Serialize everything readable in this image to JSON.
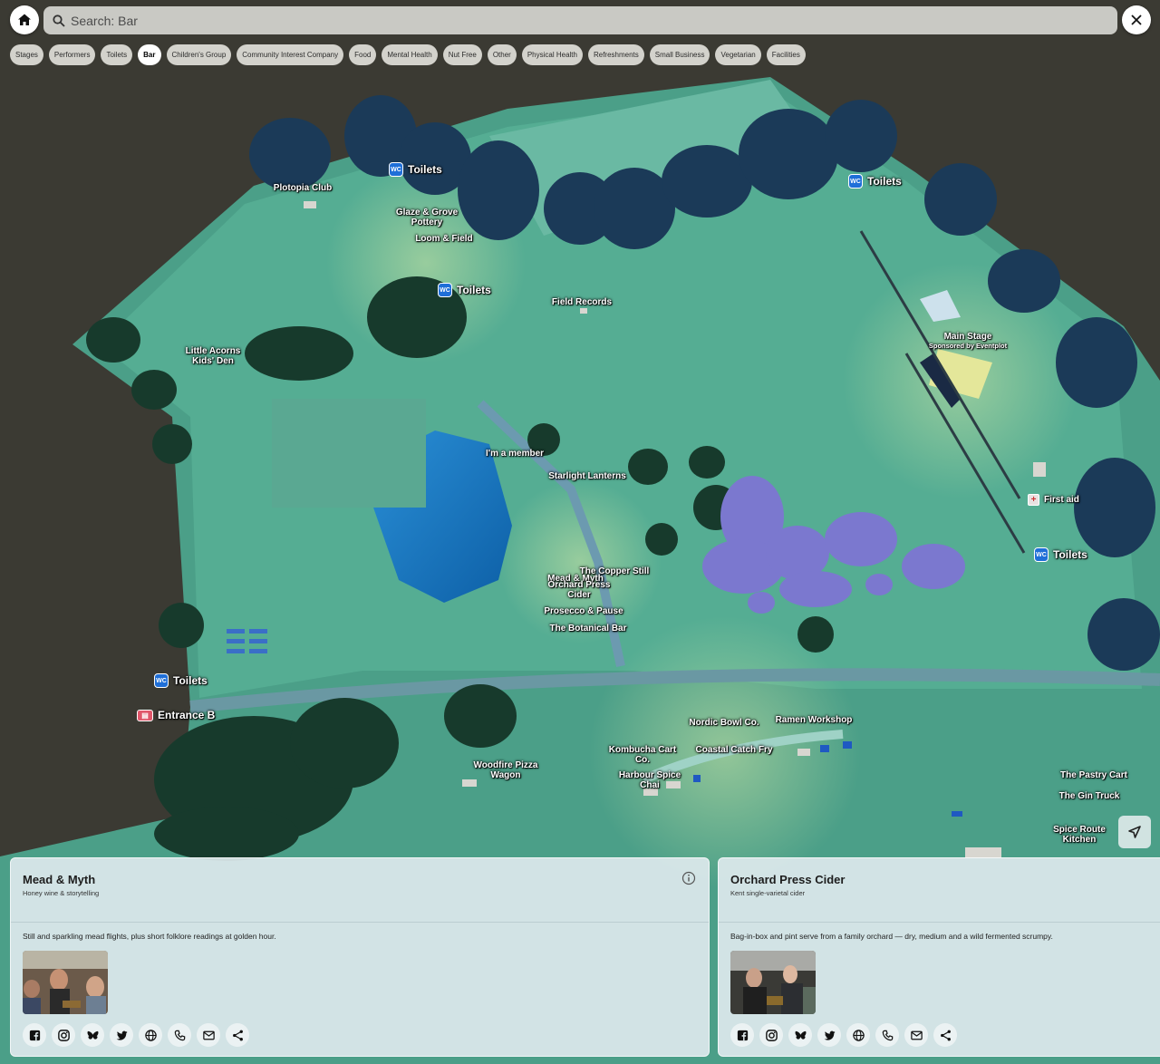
{
  "search": {
    "placeholder": "Search: Bar"
  },
  "filters": [
    {
      "label": "Stages",
      "active": false
    },
    {
      "label": "Performers",
      "active": false
    },
    {
      "label": "Toilets",
      "active": false
    },
    {
      "label": "Bar",
      "active": true
    },
    {
      "label": "Children's Group",
      "active": false
    },
    {
      "label": "Community Interest Company",
      "active": false
    },
    {
      "label": "Food",
      "active": false
    },
    {
      "label": "Mental Health",
      "active": false
    },
    {
      "label": "Nut Free",
      "active": false
    },
    {
      "label": "Other",
      "active": false
    },
    {
      "label": "Physical Health",
      "active": false
    },
    {
      "label": "Refreshments",
      "active": false
    },
    {
      "label": "Small Business",
      "active": false
    },
    {
      "label": "Vegetarian",
      "active": false
    },
    {
      "label": "Facilities",
      "active": false
    }
  ],
  "map": {
    "pois": {
      "toilets_1": {
        "icon": "WC",
        "label": "Toilets"
      },
      "toilets_2": {
        "icon": "WC",
        "label": "Toilets"
      },
      "toilets_3": {
        "icon": "WC",
        "label": "Toilets"
      },
      "toilets_4": {
        "icon": "WC",
        "label": "Toilets"
      },
      "toilets_5": {
        "icon": "WC",
        "label": "Toilets"
      },
      "entrance_b": {
        "label": "Entrance B"
      },
      "first_aid": {
        "label": "First aid"
      }
    },
    "labels": {
      "plotopia": "Plotopia Club",
      "glaze_1": "Glaze & Grove",
      "glaze_2": "Pottery",
      "loom": "Loom & Field",
      "field_records": "Field Records",
      "acorns_1": "Little Acorns",
      "acorns_2": "Kids' Den",
      "main_stage": "Main Stage",
      "main_stage_sponsor": "Sponsored by Eventplot",
      "member": "I'm a member",
      "lanterns": "Starlight Lanterns",
      "copper": "The Copper Still",
      "mead": "Mead & Myth",
      "orchard_1": "Orchard Press",
      "orchard_2": "Cider",
      "prosecco": "Prosecco & Pause",
      "botanical": "The Botanical Bar",
      "nordic": "Nordic Bowl Co.",
      "ramen": "Ramen Workshop",
      "kombucha_1": "Kombucha Cart",
      "kombucha_2": "Co.",
      "coastal": "Coastal Catch Fry",
      "harbour_1": "Harbour Spice",
      "harbour_2": "Chai",
      "woodfire_1": "Woodfire Pizza",
      "woodfire_2": "Wagon",
      "pastry": "The Pastry Cart",
      "gin": "The Gin Truck",
      "spice_1": "Spice Route",
      "spice_2": "Kitchen"
    }
  },
  "cards": [
    {
      "title": "Mead & Myth",
      "tagline": "Honey wine & storytelling",
      "description": "Still and sparkling mead flights, plus short folklore readings at golden hour."
    },
    {
      "title": "Orchard Press Cider",
      "tagline": "Kent single-varietal cider",
      "description": "Bag-in-box and pint serve from a family orchard — dry, medium and a wild fermented scrumpy."
    }
  ],
  "social_icons": [
    "facebook-icon",
    "instagram-icon",
    "bluesky-icon",
    "twitter-icon",
    "website-icon",
    "phone-icon",
    "email-icon",
    "share-icon"
  ]
}
